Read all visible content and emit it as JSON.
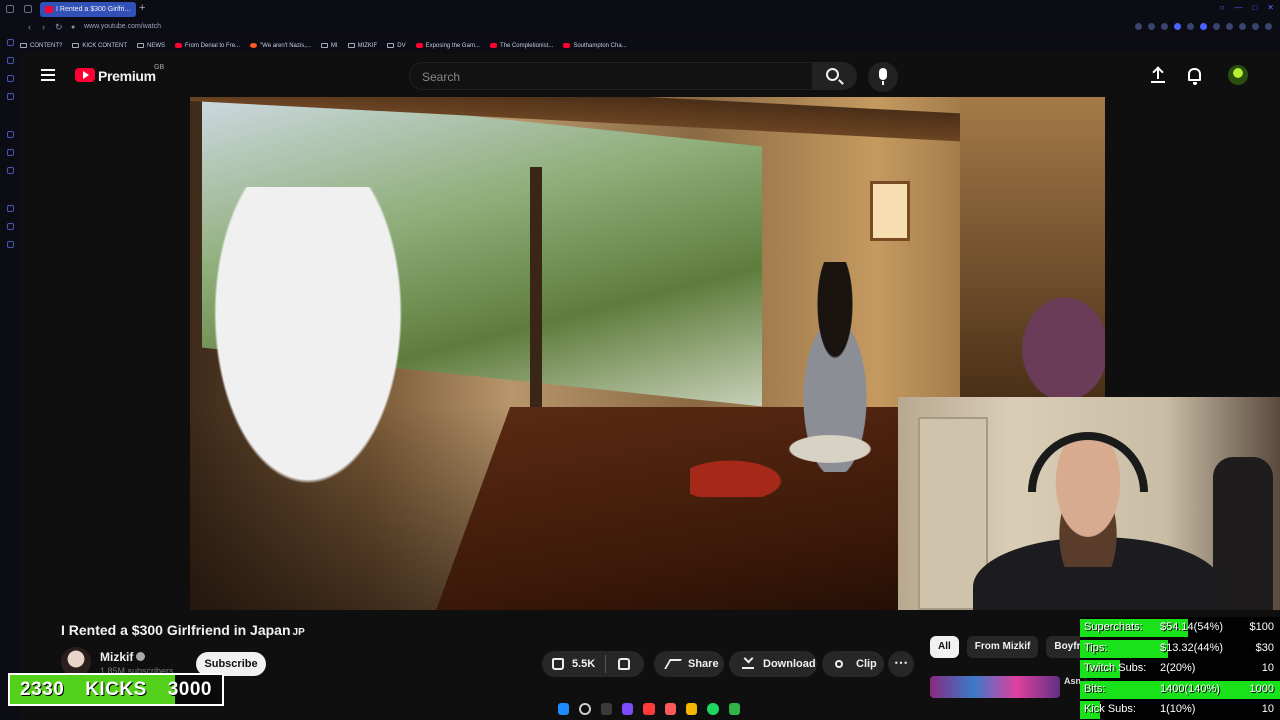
{
  "browser": {
    "tab_title": "I Rented a $300 Girlfri...",
    "url": "www.youtube.com/watch",
    "bookmarks": [
      "CONTENT?",
      "KICK CONTENT",
      "NEWS",
      "From Denial to Fre...",
      "\"We aren't Nazis,...",
      "MI",
      "MIZKIF",
      "DV",
      "Exposing the Gam...",
      "The Completionist...",
      "Southampton Cha..."
    ]
  },
  "masthead": {
    "logo_text": "Premium",
    "region": "GB",
    "search_placeholder": "Search"
  },
  "video": {
    "title": "I Rented a $300 Girlfriend in Japan",
    "title_flag": "JP",
    "channel_name": "Mizkif",
    "subscriber_count": "1.85M subscribers",
    "subscribe_label": "Subscribe",
    "like_count": "5.5K",
    "share_label": "Share",
    "download_label": "Download",
    "clip_label": "Clip",
    "more_label": "⋯"
  },
  "related": {
    "chips": [
      "All",
      "From Mizkif",
      "Boyfri"
    ],
    "next_title": "Asn Sco"
  },
  "kick_goal": {
    "current": "2330",
    "label": "KICKS",
    "target": "3000",
    "progress": 0.777
  },
  "goals": [
    {
      "label": "Superchats:",
      "value": "$54.14(54%)",
      "target": "$100",
      "progress": 0.54
    },
    {
      "label": "Tips:",
      "value": "$13.32(44%)",
      "target": "$30",
      "progress": 0.44
    },
    {
      "label": "Twitch Subs:",
      "value": "2(20%)",
      "target": "10",
      "progress": 0.2
    },
    {
      "label": "Bits:",
      "value": "1400(140%)",
      "target": "1000",
      "progress": 1.0
    },
    {
      "label": "Kick Subs:",
      "value": "1(10%)",
      "target": "10",
      "progress": 0.1
    }
  ],
  "colors": {
    "youtube_red": "#ff0033",
    "kick_green": "#53d01a",
    "goal_green": "#19e21a",
    "tab_blue": "#3150b8"
  }
}
